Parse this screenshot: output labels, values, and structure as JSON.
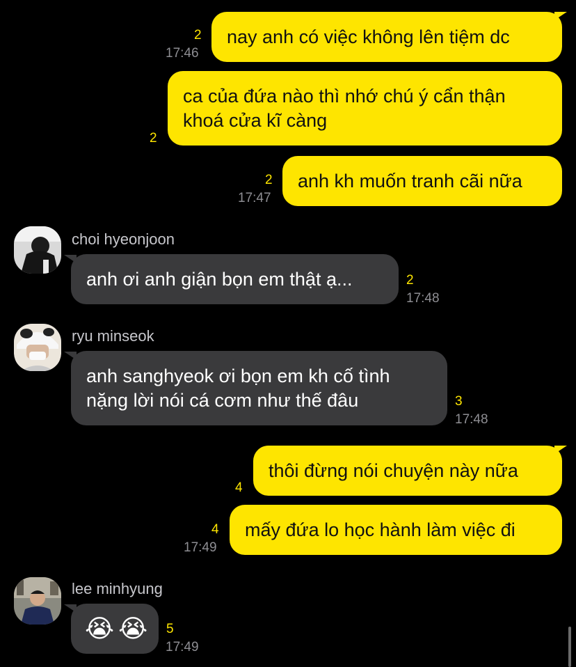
{
  "theme": {
    "outgoing_bubble": "#fee500",
    "incoming_bubble": "#3a3a3c",
    "background": "#000000",
    "unread_color": "#fee500",
    "time_color": "#8e8e93"
  },
  "messages": [
    {
      "direction": "out",
      "lines": [
        "nay anh có việc không lên tiệm dc"
      ],
      "unread": "2",
      "time": "17:46"
    },
    {
      "direction": "out",
      "lines": [
        "ca của đứa nào thì nhớ chú ý cẩn thận",
        "khoá cửa kĩ càng"
      ],
      "unread": "2",
      "time": ""
    },
    {
      "direction": "out",
      "lines": [
        "anh kh muốn tranh cãi nữa"
      ],
      "unread": "2",
      "time": "17:47"
    },
    {
      "direction": "in",
      "sender": "choi hyeonjoon",
      "avatar": "avatar-choi-hyeonjoon",
      "lines": [
        "anh ơi anh giận bọn em thật ạ..."
      ],
      "unread": "2",
      "time": "17:48"
    },
    {
      "direction": "in",
      "sender": "ryu minseok",
      "avatar": "avatar-ryu-minseok",
      "lines": [
        "anh sanghyeok ơi bọn em kh cố tình",
        "nặng lời nói cá cơm như thế đâu"
      ],
      "unread": "3",
      "time": "17:48"
    },
    {
      "direction": "out",
      "lines": [
        "thôi đừng nói chuyện này nữa"
      ],
      "unread": "4",
      "time": ""
    },
    {
      "direction": "out",
      "lines": [
        "mấy đứa lo học hành làm việc đi"
      ],
      "unread": "4",
      "time": "17:49"
    },
    {
      "direction": "in",
      "sender": "lee minhyung",
      "avatar": "avatar-lee-minhyung",
      "emoji": [
        "crying-face-icon",
        "crying-face-icon"
      ],
      "emoji_glyph": "😭",
      "unread": "5",
      "time": "17:49"
    }
  ]
}
